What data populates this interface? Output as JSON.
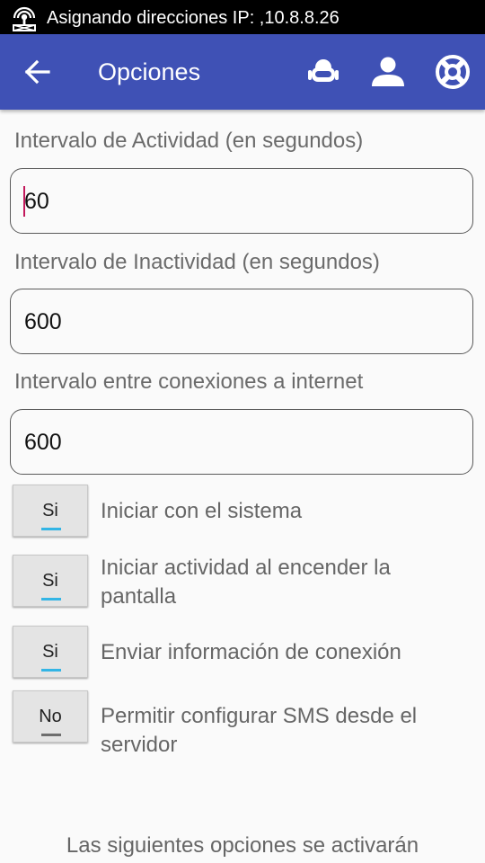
{
  "status_bar": {
    "text": "Asignando direcciones IP: ,10.8.8.26",
    "icon": "vpn-key-icon"
  },
  "app_bar": {
    "title": "Opciones",
    "background": "#3f51b5",
    "back_icon": "arrow-back-icon",
    "actions": [
      "robot-icon",
      "person-icon",
      "lifebuoy-icon"
    ]
  },
  "fields": [
    {
      "label": "Intervalo de Actividad (en segundos)",
      "value": "60",
      "focused": true
    },
    {
      "label": "Intervalo de Inactividad (en segundos)",
      "value": "600",
      "focused": false
    },
    {
      "label": "Intervalo entre conexiones a internet",
      "value": "600",
      "focused": false
    }
  ],
  "toggles": [
    {
      "state": "Si",
      "label": "Iniciar con el sistema",
      "on": true
    },
    {
      "state": "Si",
      "label": "Iniciar actividad al encender la pantalla",
      "on": true
    },
    {
      "state": "Si",
      "label": "Enviar información de conexión",
      "on": true
    },
    {
      "state": "No",
      "label": "Permitir configurar SMS desde el servidor",
      "on": false
    }
  ],
  "colors": {
    "toggle_on": "#33b5e5",
    "toggle_off": "#6e6e6e",
    "cursor": "#c2185b"
  },
  "footer_text": "Las siguientes opciones se activarán"
}
